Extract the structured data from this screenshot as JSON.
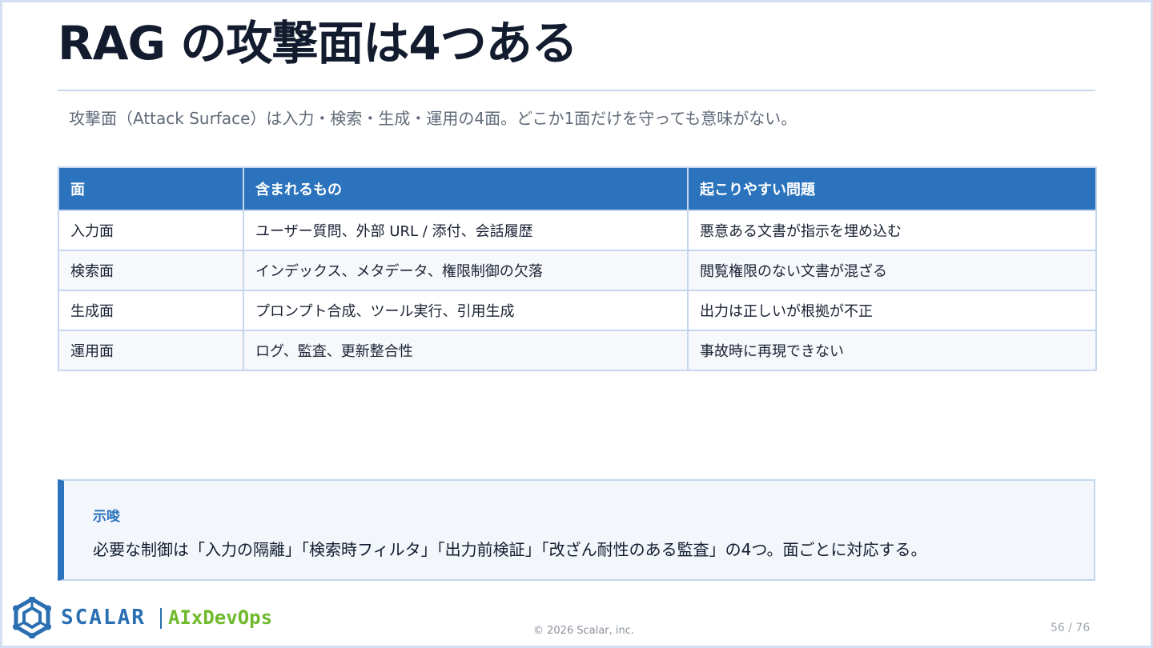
{
  "slide": {
    "title": "RAG の攻撃面は4つある",
    "subtitle": "攻撃面（Attack Surface）は入力・検索・生成・運用の4面。どこか1面だけを守っても意味がない。"
  },
  "table": {
    "headers": [
      "面",
      "含まれるもの",
      "起こりやすい問題"
    ],
    "rows": [
      [
        "入力面",
        "ユーザー質問、外部 URL / 添付、会話履歴",
        "悪意ある文書が指示を埋め込む"
      ],
      [
        "検索面",
        "インデックス、メタデータ、権限制御の欠落",
        "閲覧権限のない文書が混ざる"
      ],
      [
        "生成面",
        "プロンプト合成、ツール実行、引用生成",
        "出力は正しいが根拠が不正"
      ],
      [
        "運用面",
        "ログ、監査、更新整合性",
        "事故時に再現できない"
      ]
    ]
  },
  "callout": {
    "label": "示唆",
    "body": "必要な制御は「入力の隔離」「検索時フィルタ」「出力前検証」「改ざん耐性のある監査」の4つ。面ごとに対応する。"
  },
  "footer": {
    "logo_scalar": "SCALAR",
    "logo_ai": "AIxDevOps",
    "copyright": "© 2026 Scalar, inc.",
    "page": "56 / 76"
  },
  "colors": {
    "accent": "#2b73bd",
    "logo_blue": "#2a6fb2",
    "logo_green": "#6fba2c"
  },
  "icons": {
    "logo_mark": "scalar-logo-icon"
  }
}
